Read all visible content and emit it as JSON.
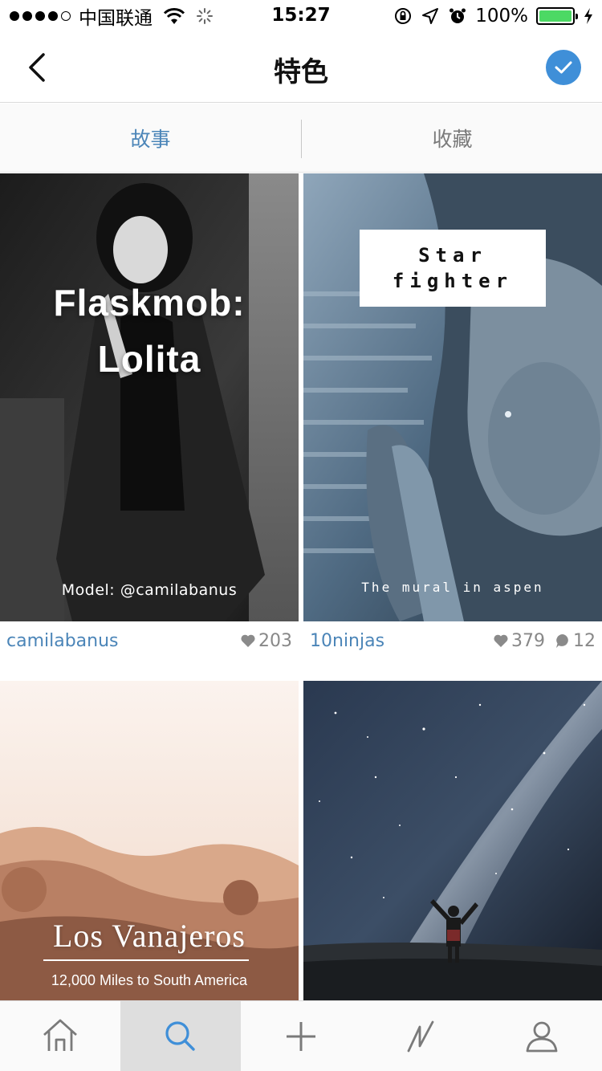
{
  "status_bar": {
    "carrier": "中国联通",
    "time": "15:27",
    "battery": "100%",
    "signal_bars_filled": 4,
    "signal_bars_total": 5
  },
  "nav": {
    "title": "特色",
    "back_icon": "chevron-left-icon",
    "action_icon": "checkmark-icon"
  },
  "segments": {
    "left": "故事",
    "right": "收藏",
    "active": "left"
  },
  "cards": [
    {
      "title_lines": [
        "Flaskmob:",
        "Lolita"
      ],
      "caption": "Model: @camilabanus",
      "username": "camilabanus",
      "likes": "203",
      "comments": null
    },
    {
      "title_lines": [
        "Star",
        "fighter"
      ],
      "caption": "The mural in aspen",
      "username": "10ninjas",
      "likes": "379",
      "comments": "12"
    },
    {
      "title_lines": [
        "Los Vanajeros"
      ],
      "caption": "12,000 Miles to South America",
      "username": null
    },
    {
      "title_lines": [],
      "caption": null,
      "username": null
    }
  ],
  "tab_bar": {
    "tabs": [
      {
        "icon": "home-icon"
      },
      {
        "icon": "search-icon"
      },
      {
        "icon": "plus-icon"
      },
      {
        "icon": "activity-icon"
      },
      {
        "icon": "profile-icon"
      }
    ],
    "active_index": 1
  },
  "colors": {
    "accent": "#4b85b8",
    "check_circle": "#3f8fd8",
    "battery_fill": "#4cd964"
  }
}
